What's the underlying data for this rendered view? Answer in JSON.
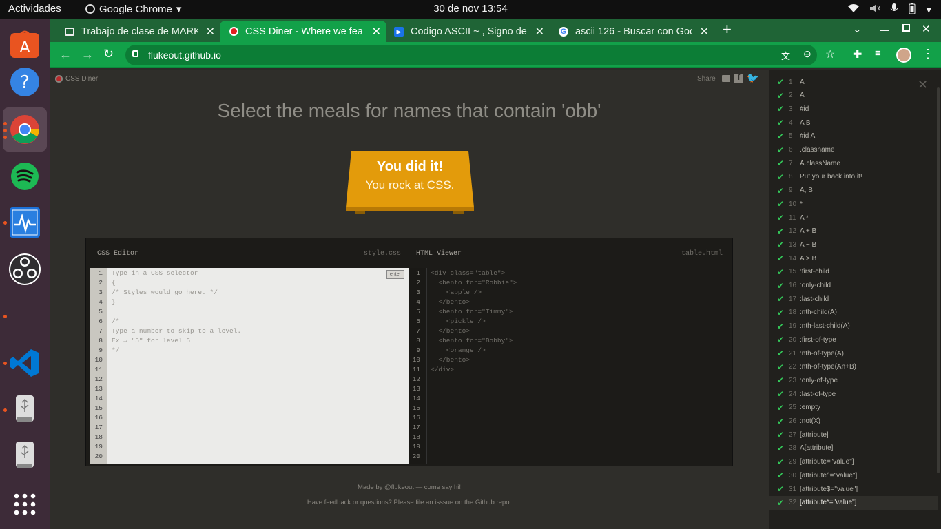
{
  "topbar": {
    "activities": "Actividades",
    "app": "Google Chrome",
    "clock": "30 de nov  13:54"
  },
  "tabs": [
    {
      "title": "Trabajo de clase de MARK"
    },
    {
      "title": "CSS Diner - Where we feas"
    },
    {
      "title": "Codigo ASCII ~ , Signo de c"
    },
    {
      "title": "ascii 126 - Buscar con Goo"
    }
  ],
  "address": {
    "url": "flukeout.github.io"
  },
  "diner": {
    "brand": "CSS Diner",
    "share": "Share",
    "instruction": "Select the meals for names that contain 'obb'",
    "win_title": "You did it!",
    "win_sub": "You rock at CSS.",
    "css_editor": {
      "title": "CSS Editor",
      "file": "style.css",
      "enter": "enter",
      "lines": [
        "Type in a CSS selector",
        "{",
        "/* Styles would go here. */",
        "}",
        "",
        "/*",
        "Type a number to skip to a level.",
        "Ex → \"5\" for level 5",
        "*/"
      ]
    },
    "html_viewer": {
      "title": "HTML Viewer",
      "file": "table.html",
      "lines": [
        "<div class=\"table\">",
        "  <bento for=\"Robbie\">",
        "    <apple />",
        "  </bento>",
        "  <bento for=\"Timmy\">",
        "    <pickle />",
        "  </bento>",
        "  <bento for=\"Bobby\">",
        "    <orange />",
        "  </bento>",
        "</div>"
      ]
    },
    "footer1": "Made by @flukeout — come say hi!",
    "footer2": "Have feedback or questions? Please file an isssue on the Github repo."
  },
  "levels": [
    "A",
    "A",
    "#id",
    "A B",
    "#id A",
    ".classname",
    "A.className",
    "Put your back into it!",
    "A, B",
    "*",
    "A *",
    "A + B",
    "A ~ B",
    "A > B",
    ":first-child",
    ":only-child",
    ":last-child",
    ":nth-child(A)",
    ":nth-last-child(A)",
    ":first-of-type",
    ":nth-of-type(A)",
    ":nth-of-type(An+B)",
    ":only-of-type",
    ":last-of-type",
    ":empty",
    ":not(X)",
    "[attribute]",
    "A[attribute]",
    "[attribute=\"value\"]",
    "[attribute^=\"value\"]",
    "[attribute$=\"value\"]",
    "[attribute*=\"value\"]"
  ],
  "colors": {
    "accent": "#12a149",
    "tray": "#e1a10a"
  }
}
